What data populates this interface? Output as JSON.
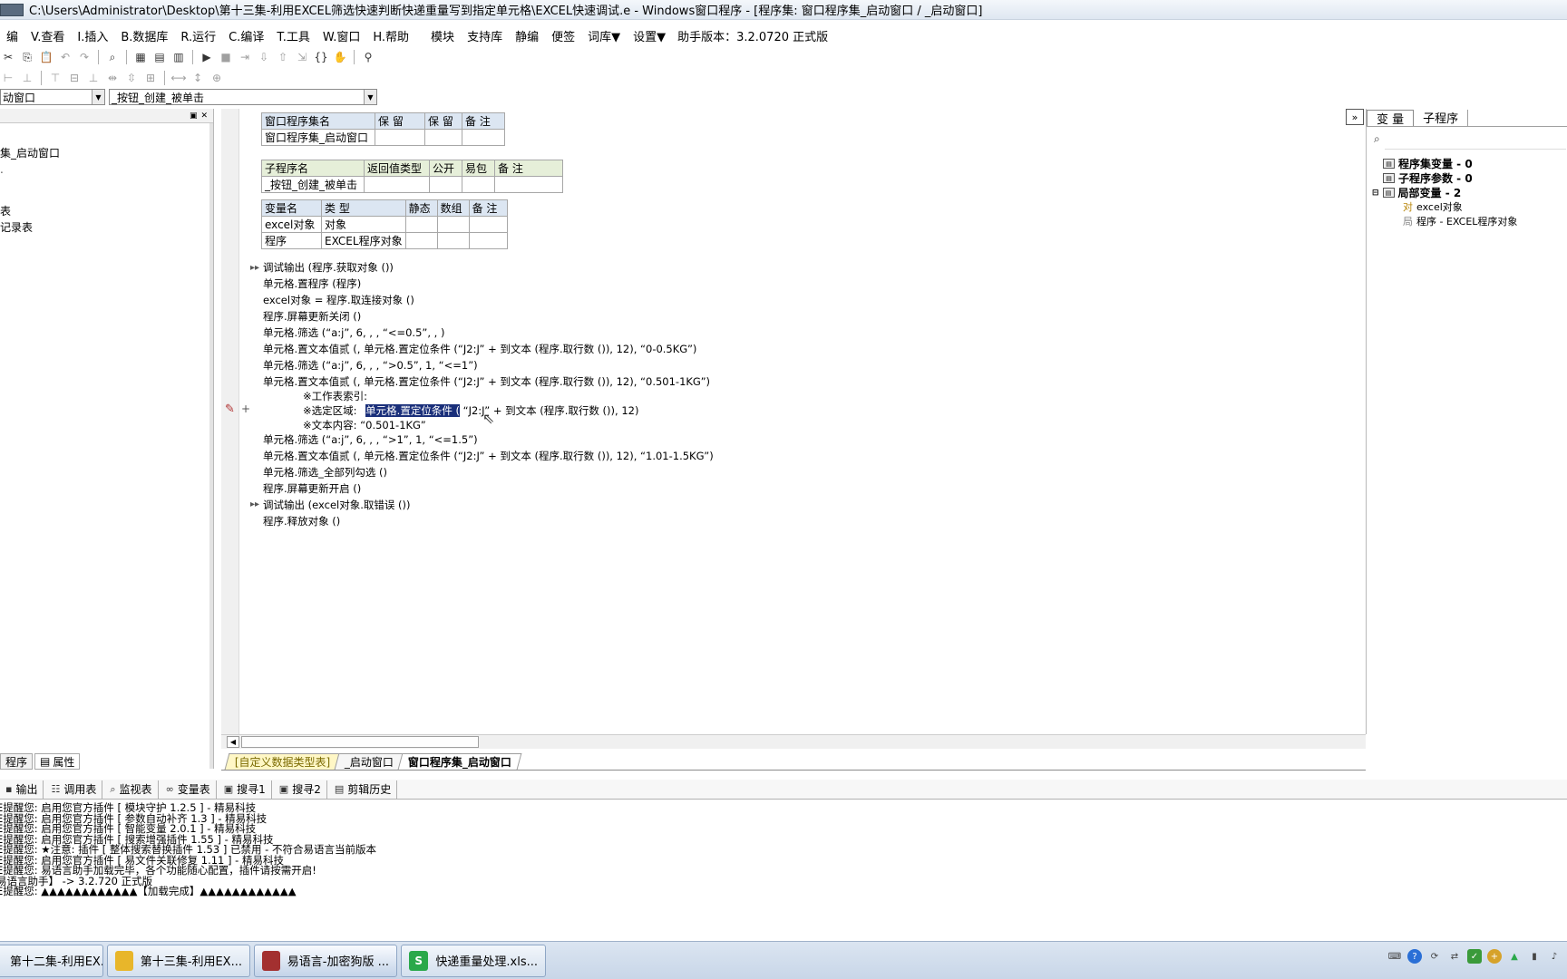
{
  "window": {
    "title": "C:\\Users\\Administrator\\Desktop\\第十三集-利用EXCEL筛选快速判断快递重量写到指定单元格\\EXCEL快速调试.e - Windows窗口程序 - [程序集: 窗口程序集_启动窗口 / _启动窗口]"
  },
  "menu": {
    "items": [
      "编",
      "V.查看",
      "I.插入",
      "B.数据库",
      "R.运行",
      "C.编译",
      "T.工具",
      "W.窗口",
      "H.帮助",
      "模块",
      "支持库",
      "静编",
      "便签",
      "词库▼",
      "设置▼"
    ],
    "version": "助手版本：3.2.0720 正式版"
  },
  "combos": {
    "window_select": "动窗口",
    "method_select": "_按钮_创建_被单击"
  },
  "left_panel": {
    "items": [
      "集_启动窗口",
      "表",
      "记录表"
    ],
    "tabs": [
      "程序",
      "属性"
    ]
  },
  "editor": {
    "assembly_table": {
      "headers": [
        "窗口程序集名",
        "保 留",
        "保 留",
        "备 注"
      ],
      "row": [
        "窗口程序集_启动窗口",
        "",
        "",
        ""
      ]
    },
    "sub_table": {
      "headers": [
        "子程序名",
        "返回值类型",
        "公开",
        "易包",
        "备 注"
      ],
      "row": [
        "_按钮_创建_被单击",
        "",
        "",
        "",
        ""
      ]
    },
    "var_table": {
      "headers": [
        "变量名",
        "类 型",
        "静态",
        "数组",
        "备 注"
      ],
      "rows": [
        [
          "excel对象",
          "对象",
          "",
          "",
          ""
        ],
        [
          "程序",
          "EXCEL程序对象",
          "",
          "",
          ""
        ]
      ]
    },
    "code_lines": [
      "调试输出 (程序.获取对象 ())",
      "单元格.置程序 (程序)",
      "excel对象 = 程序.取连接对象 ()",
      "程序.屏幕更新关闭 ()",
      "单元格.筛选 (“a:j”, 6, , , “<=0.5”, , )",
      "单元格.置文本值贰 (, 单元格.置定位条件 (“J2:J” + 到文本 (程序.取行数 ()), 12), “0-0.5KG”)",
      "单元格.筛选 (“a:j”, 6, , , “>0.5”, 1, “<=1”)",
      "单元格.置文本值贰 (, 单元格.置定位条件 (“J2:J” + 到文本 (程序.取行数 ()), 12), “0.501-1KG”)",
      "※工作表索引:",
      "※选定区域:",
      "单元格.置定位条件 (",
      "“J2:J” + 到文本 (程序.取行数 ()), 12)",
      "※文本内容:  “0.501-1KG”",
      "单元格.筛选 (“a:j”, 6, , , “>1”, 1, “<=1.5”)",
      "单元格.置文本值贰 (, 单元格.置定位条件 (“J2:J” + 到文本 (程序.取行数 ()), 12), “1.01-1.5KG”)",
      "单元格.筛选_全部列勾选 ()",
      "程序.屏幕更新开启 ()",
      "调试输出 (excel对象.取错误 ())",
      "程序.释放对象 ()"
    ],
    "tabs": [
      "[自定义数据类型表]",
      "_启动窗口",
      "窗口程序集_启动窗口"
    ]
  },
  "right_panel": {
    "tabs": [
      "变 量",
      "子程序"
    ],
    "search_icon": "search-icon",
    "tree": [
      "程序集变量 - 0",
      "子程序参数 - 0",
      "局部变量 - 2",
      "excel对象",
      "程序 - EXCEL程序对象"
    ],
    "tree_prefix": [
      "对",
      "局"
    ]
  },
  "bottom_panel": {
    "tabs": [
      "输出",
      "调用表",
      "监视表",
      "变量表",
      "搜寻1",
      "搜寻2",
      "剪辑历史"
    ],
    "output_lines": [
      "E提醒您: 启用您官方插件 [ 模块守护 1.2.5 ] - 精易科技",
      "E提醒您: 启用您官方插件 [ 参数自动补齐 1.3 ] - 精易科技",
      "E提醒您: 启用您官方插件 [ 智能变量 2.0.1 ] - 精易科技",
      "E提醒您: 启用您官方插件 [ 搜索增强插件 1.55 ] - 精易科技",
      "E提醒您: ★注意: 插件 [ 整体搜索替换插件 1.53 ] 已禁用 - 不符合易语言当前版本",
      "E提醒您: 启用您官方插件 [ 易文件关联修复 1.11 ] - 精易科技",
      "E提醒您: 易语言助手加载完毕，各个功能随心配置，插件请按需开启!",
      "易语言助手】 -> 3.2.720 正式版",
      "E提醒您: ▲▲▲▲▲▲▲▲▲▲▲▲【加载完成】▲▲▲▲▲▲▲▲▲▲▲▲"
    ]
  },
  "taskbar": {
    "tasks": [
      "第十二集-利用EX...",
      "第十三集-利用EX...",
      "易语言-加密狗版 ...",
      "快递重量处理.xls..."
    ],
    "colors": {
      "task1": "#d9352a",
      "task2": "#e8b62a",
      "task3": "#a33030",
      "task4": "#2aa84a"
    }
  }
}
